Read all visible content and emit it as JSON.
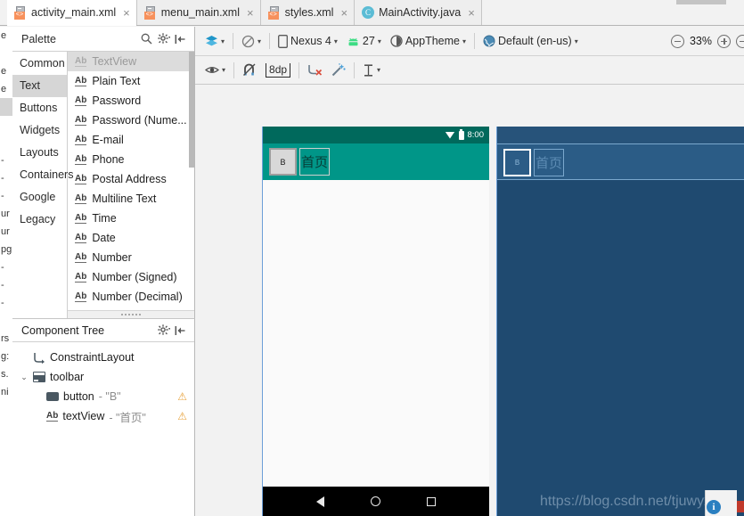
{
  "tabs": [
    {
      "label": "activity_main.xml",
      "icon": "xml-file-icon",
      "active": true,
      "close": "×"
    },
    {
      "label": "menu_main.xml",
      "icon": "xml-file-icon",
      "active": false,
      "close": "×"
    },
    {
      "label": "styles.xml",
      "icon": "xml-file-icon",
      "active": false,
      "close": "×"
    },
    {
      "label": "MainActivity.java",
      "icon": "java-file-icon",
      "active": false,
      "close": "×",
      "badge": "C"
    }
  ],
  "palette": {
    "title": "Palette",
    "icons": {
      "search": "search-icon",
      "settings": "gear-icon",
      "collapse": "collapse-icon"
    },
    "categories": [
      {
        "label": "Common",
        "selected": false
      },
      {
        "label": "Text",
        "selected": true
      },
      {
        "label": "Buttons",
        "selected": false
      },
      {
        "label": "Widgets",
        "selected": false
      },
      {
        "label": "Layouts",
        "selected": false
      },
      {
        "label": "Containers",
        "selected": false
      },
      {
        "label": "Google",
        "selected": false
      },
      {
        "label": "Legacy",
        "selected": false
      }
    ],
    "items": [
      {
        "label": "TextView",
        "glyph": "Ab",
        "selected": true
      },
      {
        "label": "Plain Text",
        "glyph": "Ab",
        "selected": false
      },
      {
        "label": "Password",
        "glyph": "Ab",
        "selected": false
      },
      {
        "label": "Password (Nume...",
        "glyph": "Ab",
        "selected": false
      },
      {
        "label": "E-mail",
        "glyph": "Ab",
        "selected": false
      },
      {
        "label": "Phone",
        "glyph": "Ab",
        "selected": false
      },
      {
        "label": "Postal Address",
        "glyph": "Ab",
        "selected": false
      },
      {
        "label": "Multiline Text",
        "glyph": "Ab",
        "selected": false
      },
      {
        "label": "Time",
        "glyph": "Ab",
        "selected": false
      },
      {
        "label": "Date",
        "glyph": "Ab",
        "selected": false
      },
      {
        "label": "Number",
        "glyph": "Ab",
        "selected": false
      },
      {
        "label": "Number (Signed)",
        "glyph": "Ab",
        "selected": false
      },
      {
        "label": "Number (Decimal)",
        "glyph": "Ab",
        "selected": false
      }
    ]
  },
  "component_tree": {
    "title": "Component Tree",
    "icons": {
      "settings": "gear-icon",
      "collapse": "collapse-icon"
    },
    "nodes": [
      {
        "label": "ConstraintLayout",
        "value": "",
        "icon": "constraint-layout-icon",
        "indent": 0,
        "chevron": "",
        "warning": false
      },
      {
        "label": "toolbar",
        "value": "",
        "icon": "toolbar-icon",
        "indent": 0,
        "chevron": "⌄",
        "warning": false
      },
      {
        "label": "button",
        "value": "- \"B\"",
        "icon": "button-icon",
        "indent": 1,
        "chevron": "",
        "warning": true,
        "warn_glyph": "⚠"
      },
      {
        "label": "textView",
        "value": "- \"首页\"",
        "icon": "textview-icon",
        "indent": 1,
        "chevron": "",
        "warning": true,
        "warn_glyph": "⚠"
      }
    ]
  },
  "toolbar_primary": {
    "design_mode": {
      "label": "",
      "icon": "layers-icon",
      "caret": "▾"
    },
    "blueprint_mode": {
      "label": "",
      "icon": "blueprint-toggle-icon",
      "caret": "▾"
    },
    "device": {
      "label": "Nexus 4",
      "icon": "phone-icon",
      "caret": "▾"
    },
    "api": {
      "label": "27",
      "icon": "android-icon",
      "caret": "▾"
    },
    "theme": {
      "label": "AppTheme",
      "icon": "theme-icon",
      "caret": "▾"
    },
    "locale": {
      "label": "Default (en-us)",
      "icon": "globe-icon",
      "caret": "▾"
    },
    "zoom": {
      "value": "33%",
      "out_icon": "zoom-out-icon",
      "in_icon": "zoom-in-icon",
      "fit_icon": "zoom-fit-icon"
    }
  },
  "toolbar_secondary": {
    "visibility": {
      "icon": "eye-icon",
      "caret": "▾"
    },
    "autoconnect": {
      "icon": "magnet-off-icon"
    },
    "margin": {
      "label": "8dp",
      "icon": "default-margin-icon"
    },
    "clear_constraints": {
      "icon": "clear-constraints-icon"
    },
    "infer_constraints": {
      "icon": "magic-wand-icon"
    },
    "guidelines": {
      "icon": "baseline-icon",
      "caret": "▾"
    }
  },
  "preview": {
    "status_bar": {
      "time": "8:00",
      "wifi_icon": "wifi-icon",
      "battery_icon": "battery-icon"
    },
    "app_bar": {
      "button_label": "B",
      "text_label": "首页"
    },
    "nav_bar": {
      "back_icon": "nav-back-icon",
      "home_icon": "nav-home-icon",
      "recents_icon": "nav-recents-icon"
    },
    "colors": {
      "status_bar": "#00695c",
      "app_bar": "#009688",
      "content": "#fafafa",
      "nav_bar": "#000000"
    }
  },
  "blueprint": {
    "button_label": "B",
    "text_label": "首页",
    "colors": {
      "background": "#1f4a70",
      "stroke": "#7aa8cd",
      "selection": "#ffffff"
    }
  },
  "watermark": {
    "text": "https://blog.csdn.net/tjuwyx"
  },
  "status": {
    "info_icon": "info-icon",
    "info_glyph": "i"
  },
  "left_sliver": {
    "fragments": [
      "e",
      "",
      "e",
      "e",
      "",
      "",
      "",
      "-",
      "-",
      "-",
      "ur",
      "ur",
      "pg",
      "-",
      "-",
      "-",
      "",
      "rs",
      "g:",
      "s.",
      "ni"
    ]
  }
}
